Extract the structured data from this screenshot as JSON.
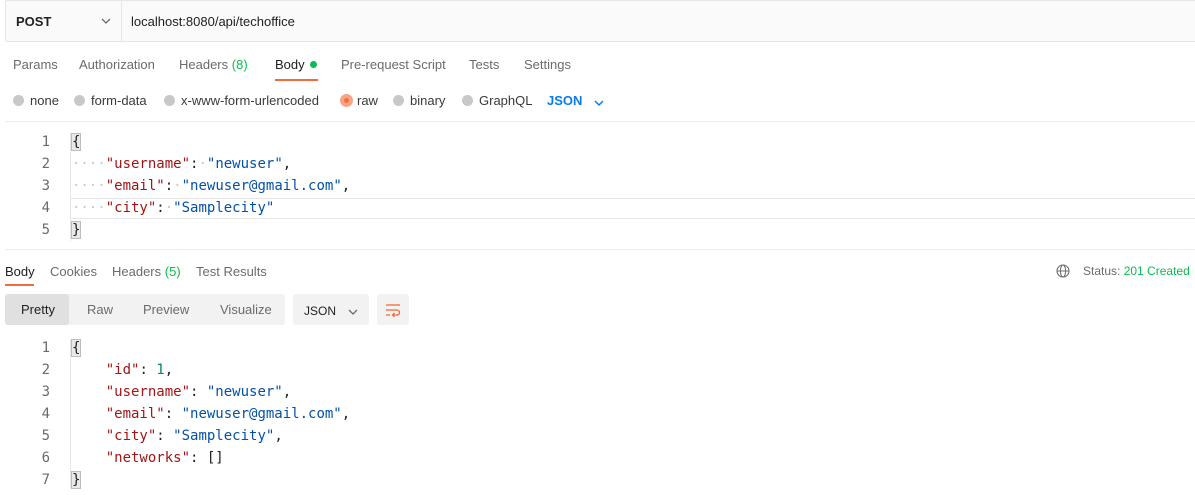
{
  "request": {
    "method": "POST",
    "url": "localhost:8080/api/techoffice"
  },
  "request_tabs": {
    "params": "Params",
    "authorization": "Authorization",
    "headers": "Headers",
    "headers_count": "(8)",
    "body": "Body",
    "prerequest": "Pre-request Script",
    "tests": "Tests",
    "settings": "Settings"
  },
  "body_types": {
    "none": "none",
    "form_data": "form-data",
    "urlencoded": "x-www-form-urlencoded",
    "raw": "raw",
    "binary": "binary",
    "graphql": "GraphQL",
    "format": "JSON",
    "selected": "raw"
  },
  "request_body": {
    "line_numbers": [
      "1",
      "2",
      "3",
      "4",
      "5"
    ],
    "open_brace": "{",
    "close_brace": "}",
    "fields": [
      {
        "key": "\"username\"",
        "value": "\"newuser\"",
        "comma": ","
      },
      {
        "key": "\"email\"",
        "value": "\"newuser@gmail.com\"",
        "comma": ","
      },
      {
        "key": "\"city\"",
        "value": "\"Samplecity\"",
        "comma": ""
      }
    ]
  },
  "response_tabs": {
    "body": "Body",
    "cookies": "Cookies",
    "headers": "Headers",
    "headers_count": "(5)",
    "test_results": "Test Results"
  },
  "status": {
    "label": "Status:",
    "value": "201 Created"
  },
  "view_modes": {
    "pretty": "Pretty",
    "raw": "Raw",
    "preview": "Preview",
    "visualize": "Visualize",
    "format": "JSON"
  },
  "response_body": {
    "line_numbers": [
      "1",
      "2",
      "3",
      "4",
      "5",
      "6",
      "7"
    ],
    "open_brace": "{",
    "close_brace": "}",
    "fields": [
      {
        "key": "\"id\"",
        "value": "1",
        "comma": ","
      },
      {
        "key": "\"username\"",
        "value": "\"newuser\"",
        "comma": ","
      },
      {
        "key": "\"email\"",
        "value": "\"newuser@gmail.com\"",
        "comma": ","
      },
      {
        "key": "\"city\"",
        "value": "\"Samplecity\"",
        "comma": ","
      },
      {
        "key": "\"networks\"",
        "value": "[]",
        "comma": ""
      }
    ]
  },
  "colors": {
    "accent": "#f26b3a",
    "success": "#0cbb52",
    "link": "#097bed"
  }
}
